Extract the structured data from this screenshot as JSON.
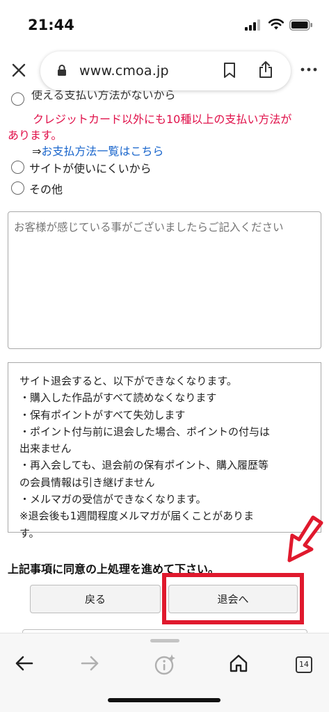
{
  "status_bar": {
    "time": "21:44"
  },
  "browser": {
    "url": "www.cmoa.jp",
    "tab_count": "14"
  },
  "form": {
    "cut_option_label": "使える支払い方法がないから",
    "promo_line1": "クレジットカード以外にも10種以上の支払い方法が",
    "promo_line2": "あります。",
    "link_arrow": "⇒",
    "link_text": "お支払方法一覧はこちら",
    "options": [
      {
        "label": "サイトが使いにくいから",
        "checked": false
      },
      {
        "label": "その他",
        "checked": false
      }
    ],
    "comment_placeholder": "お客様が感じている事がございましたらご記入ください",
    "comment_value": ""
  },
  "notice": {
    "lines": [
      "サイト退会すると、以下ができなくなります。",
      "・購入した作品がすべて読めなくなります",
      "・保有ポイントがすべて失効します",
      "・ポイント付与前に退会した場合、ポイントの付与は",
      "出来ません",
      "・再入会しても、退会前の保有ポイント、購入履歴等",
      "の会員情報は引き継げません",
      "・メルマガの受信ができなくなります。",
      "※退会後も1週間程度メルマガが届くことがありま",
      "す。"
    ]
  },
  "agreement": "上記事項に同意の上処理を進めて下さい。",
  "buttons": {
    "back": "戻る",
    "withdraw": "退会へ"
  },
  "annotation": {
    "color": "#e0192d"
  }
}
